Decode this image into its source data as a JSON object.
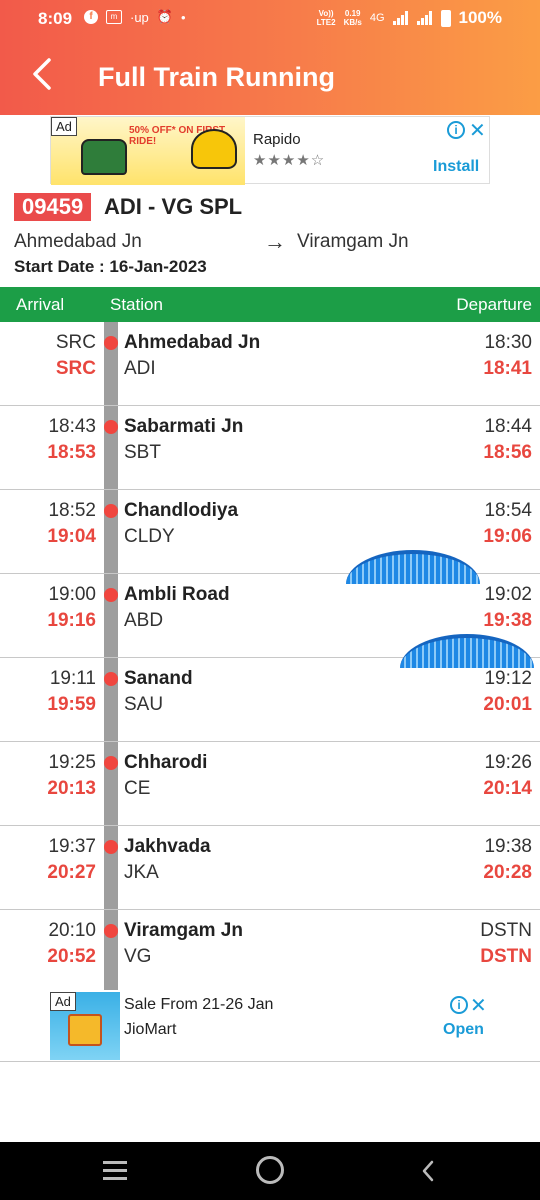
{
  "status_bar": {
    "time": "8:09",
    "net_speed_top": "0.19",
    "net_speed_bottom": "KB/s",
    "volte_top": "Vo))",
    "volte_bottom": "LTE2",
    "network_label": "4G",
    "battery": "100%"
  },
  "header": {
    "title": "Full Train Running"
  },
  "ad_top": {
    "badge": "Ad",
    "promo": "50% OFF* ON FIRST RIDE!",
    "title": "Rapido",
    "stars": "★★★★☆",
    "action": "Install"
  },
  "train": {
    "number": "09459",
    "name": "ADI - VG SPL",
    "from": "Ahmedabad Jn",
    "to": "Viramgam Jn",
    "arrow": "→",
    "start_date": "Start Date : 16-Jan-2023"
  },
  "table": {
    "header_arrival": "Arrival",
    "header_station": "Station",
    "header_departure": "Departure"
  },
  "stops": [
    {
      "arr": "SRC",
      "arr_act": "SRC",
      "name": "Ahmedabad Jn",
      "code": "ADI",
      "dep": "18:30",
      "dep_act": "18:41"
    },
    {
      "arr": "18:43",
      "arr_act": "18:53",
      "name": "Sabarmati Jn",
      "code": "SBT",
      "dep": "18:44",
      "dep_act": "18:56"
    },
    {
      "arr": "18:52",
      "arr_act": "19:04",
      "name": "Chandlodiya",
      "code": "CLDY",
      "dep": "18:54",
      "dep_act": "19:06"
    },
    {
      "arr": "19:00",
      "arr_act": "19:16",
      "name": "Ambli Road",
      "code": "ABD",
      "dep": "19:02",
      "dep_act": "19:38"
    },
    {
      "arr": "19:11",
      "arr_act": "19:59",
      "name": "Sanand",
      "code": "SAU",
      "dep": "19:12",
      "dep_act": "20:01"
    },
    {
      "arr": "19:25",
      "arr_act": "20:13",
      "name": "Chharodi",
      "code": "CE",
      "dep": "19:26",
      "dep_act": "20:14"
    },
    {
      "arr": "19:37",
      "arr_act": "20:27",
      "name": "Jakhvada",
      "code": "JKA",
      "dep": "19:38",
      "dep_act": "20:28"
    },
    {
      "arr": "20:10",
      "arr_act": "20:52",
      "name": "Viramgam Jn",
      "code": "VG",
      "dep": "DSTN",
      "dep_act": "DSTN"
    }
  ],
  "ad_bottom": {
    "badge": "Ad",
    "title": "Sale From 21-26 Jan",
    "brand": "JioMart",
    "action": "Open"
  },
  "colors": {
    "header_gradient_start": "#f25a4a",
    "header_gradient_end": "#fb9d45",
    "table_header": "#1c9e47",
    "actual_time": "#e8473f",
    "train_badge": "#ea4b4b",
    "link_blue": "#1a9bd7"
  }
}
